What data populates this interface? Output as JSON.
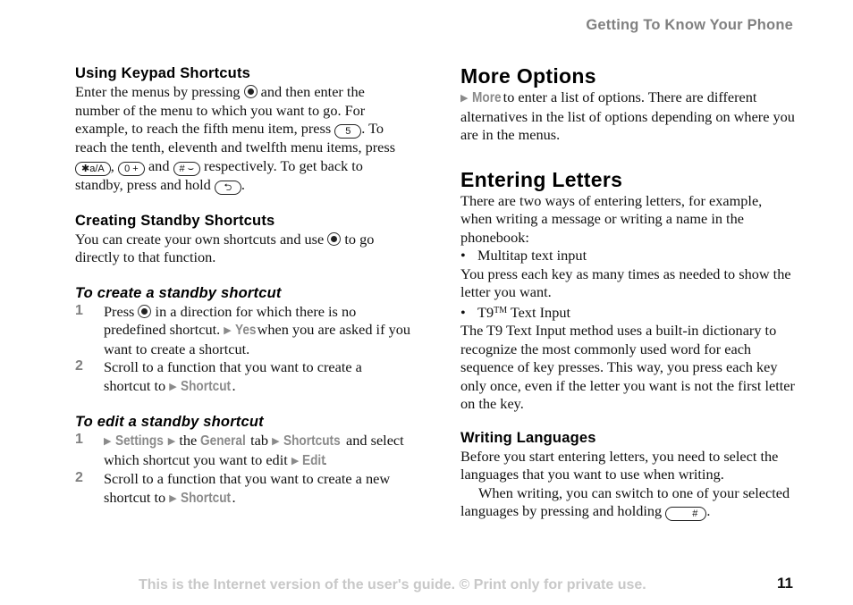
{
  "header": {
    "running_title": "Getting To Know Your Phone"
  },
  "left": {
    "keypad": {
      "title": "Using Keypad Shortcuts",
      "t1": "Enter the menus by pressing",
      "t2": "and then enter the number of the menu to which you want to go. For example, to reach the fifth menu item, press",
      "key5": "5",
      "t3": ". To reach the tenth, eleventh and twelfth menu items, press",
      "key_star": "✱a/A",
      "key_zero": "0 +",
      "t4": "and",
      "key_hash": "# ⌣",
      "t5": "respectively. To get back to standby, press and hold",
      "key_back": "⮌",
      "t6": "."
    },
    "standby": {
      "title": "Creating Standby Shortcuts",
      "t1": "You can create your own shortcuts and use",
      "t2": "to go directly to that function."
    },
    "create": {
      "title": "To create a standby shortcut",
      "steps": [
        {
          "num": "1",
          "t1": "Press",
          "t2": "in a direction for which there is no predefined shortcut.",
          "menu1": "Yes",
          "t3": "when you are asked if you want to create a shortcut."
        },
        {
          "num": "2",
          "t1": "Scroll to a function that you want to create a shortcut to",
          "menu1": "Shortcut",
          "t2": "."
        }
      ]
    },
    "edit": {
      "title": "To edit a standby shortcut",
      "steps": [
        {
          "num": "1",
          "menu1": "Settings",
          "t1": "the",
          "menu2": "General",
          "t2": "tab",
          "menu3": "Shortcuts",
          "t3": "and select which shortcut you want to edit",
          "menu4": "Edit",
          "t4": "."
        },
        {
          "num": "2",
          "t1": "Scroll to a function that you want to create a new shortcut to",
          "menu1": "Shortcut",
          "t2": "."
        }
      ]
    }
  },
  "right": {
    "more": {
      "title": "More Options",
      "menu1": "More",
      "t1": "to enter a list of options. There are different alternatives in the list of options depending on where you are in the menus."
    },
    "letters": {
      "title": "Entering Letters",
      "intro": "There are two ways of entering letters, for example, when writing a message or writing a name in the phonebook:",
      "bullet1": "Multitap text input",
      "desc1": "You press each key as many times as needed to show the letter you want.",
      "bullet2_a": "T9",
      "bullet2_tm": "TM",
      "bullet2_b": " Text Input",
      "desc2": "The T9 Text Input method uses a built-in dictionary to recognize the most commonly used word for each sequence of key presses. This way, you press each key only once, even if the letter you want is not the first letter on the key."
    },
    "languages": {
      "title": "Writing Languages",
      "p1": "Before you start entering letters, you need to select the languages that you want to use when writing.",
      "p2": "When writing, you can switch to one of your selected languages by pressing and holding",
      "key_hash": "#",
      "p2_end": "."
    }
  },
  "footer": {
    "notice": "This is the Internet version of the user's guide. © Print only for private use.",
    "page_number": "11"
  },
  "glyphs": {
    "arrow": "▶",
    "bullet": "•"
  }
}
